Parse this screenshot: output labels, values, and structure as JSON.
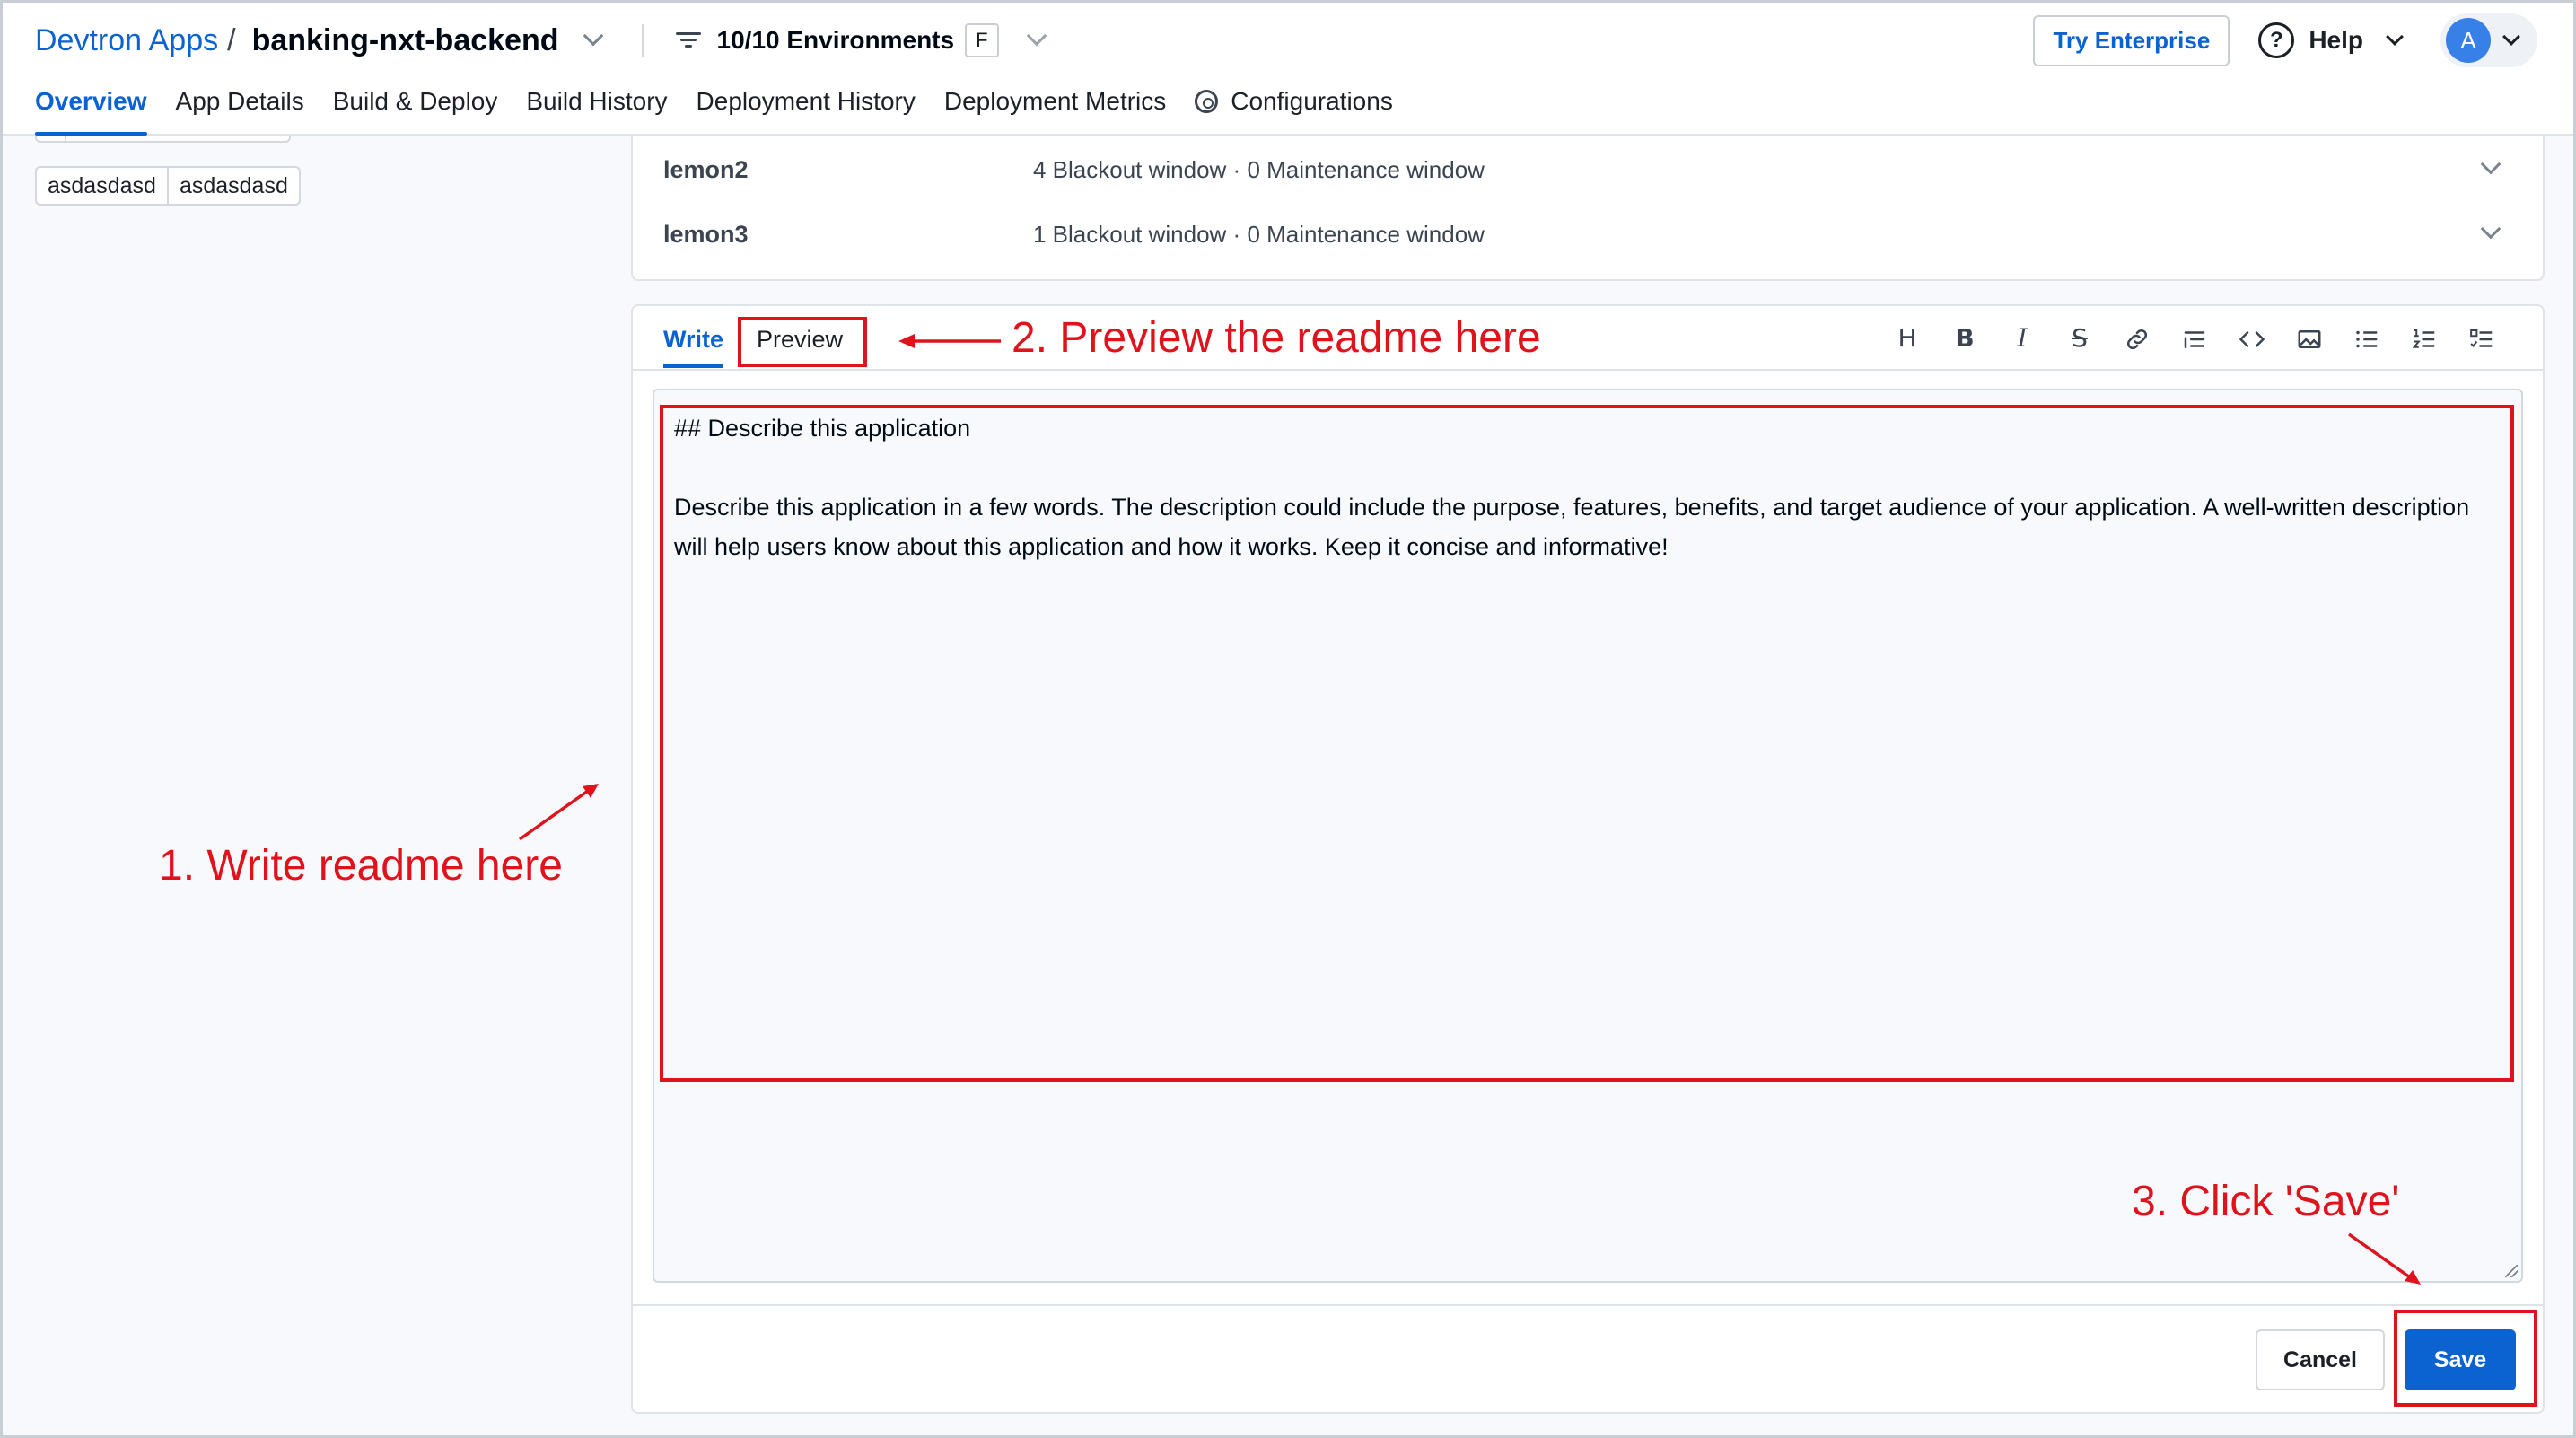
{
  "header": {
    "breadcrumb_root": "Devtron Apps",
    "breadcrumb_sep": "/",
    "app_name": "banking-nxt-backend",
    "environments": "10/10 Environments",
    "env_shortcut": "F",
    "try_enterprise": "Try Enterprise",
    "help_icon": "?",
    "help": "Help",
    "avatar_initial": "A"
  },
  "tabs": [
    {
      "label": "Overview",
      "active": true
    },
    {
      "label": "App Details"
    },
    {
      "label": "Build & Deploy"
    },
    {
      "label": "Build History"
    },
    {
      "label": "Deployment History"
    },
    {
      "label": "Deployment Metrics"
    },
    {
      "label": "Configurations",
      "icon": "gear-icon"
    }
  ],
  "left_panel": {
    "tags": [
      {
        "key": "asdasdasd",
        "value": "asdasdasd"
      }
    ]
  },
  "deployment_windows": [
    {
      "name": "lemon2",
      "info": "4 Blackout window · 0 Maintenance window"
    },
    {
      "name": "lemon3",
      "info": "1 Blackout window · 0 Maintenance window"
    }
  ],
  "readme": {
    "tab_write": "Write",
    "tab_preview": "Preview",
    "toolbar": [
      "H",
      "B",
      "I",
      "S",
      "link-icon",
      "quote-icon",
      "code-icon",
      "image-icon",
      "bullet-list-icon",
      "numbered-list-icon",
      "checklist-icon"
    ],
    "content": "## Describe this application\n\nDescribe this application in a few words. The description could include the purpose, features, benefits, and target audience of your application. A well-written description will help users know about this application and how it works. Keep it concise and informative!",
    "cancel": "Cancel",
    "save": "Save"
  },
  "annotations": {
    "step1": "1. Write readme here",
    "step2": "2. Preview the readme here",
    "step3": "3. Click 'Save'",
    "color": "#e0131d"
  },
  "colors": {
    "accent": "#0b62d1",
    "background": "#f7f9fc"
  }
}
